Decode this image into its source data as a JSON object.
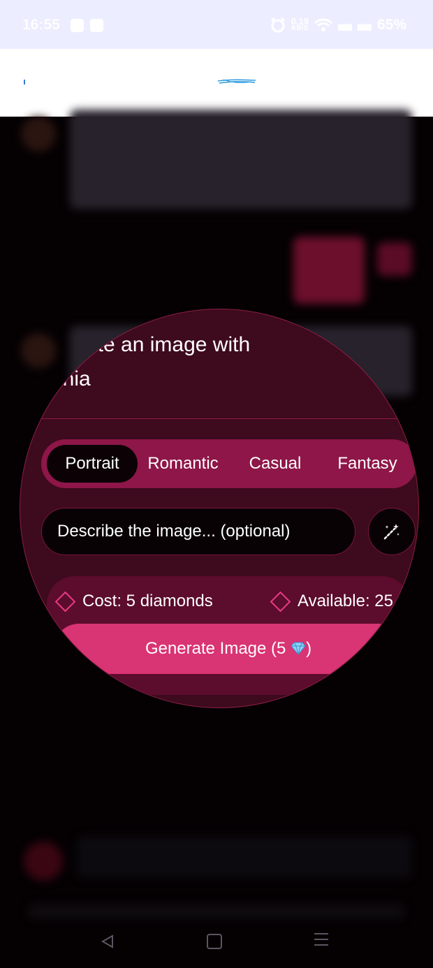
{
  "status_bar": {
    "time": "16:55",
    "net_speed_top": "0.19",
    "net_speed_bottom": "KB/S",
    "battery": "65%"
  },
  "image_dialog": {
    "title_line1": "ate an image with",
    "title_line2": "phia",
    "styles": [
      {
        "label": "Portrait",
        "active": true
      },
      {
        "label": "Romantic",
        "active": false
      },
      {
        "label": "Casual",
        "active": false
      },
      {
        "label": "Fantasy",
        "active": false
      }
    ],
    "prompt_placeholder": "Describe the image... (optional)",
    "prompt_value": "",
    "cost_label": "Cost: 5 diamonds",
    "available_label": "Available: 25",
    "generate_label": "Generate Image (5",
    "generate_suffix": ")"
  },
  "colors": {
    "accent": "#d93473",
    "tab_bg": "#8e1648",
    "dialog_bg": "#3e0a1d",
    "diamond": "#e93a86"
  }
}
